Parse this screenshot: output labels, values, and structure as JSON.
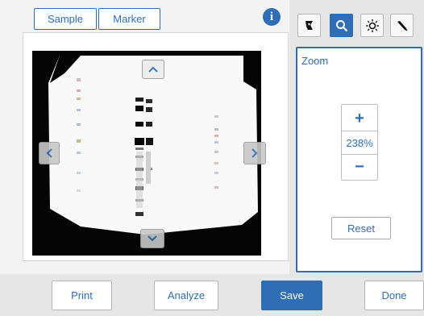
{
  "tabs": {
    "sample_label": "Sample",
    "marker_label": "Marker"
  },
  "info": {
    "label": "i",
    "icon": "info-icon"
  },
  "image_view": {
    "nav_icons": [
      "chevron-up-icon",
      "chevron-down-icon",
      "chevron-left-icon",
      "chevron-right-icon"
    ]
  },
  "toolbar": {
    "tools": [
      {
        "name": "crop",
        "icon": "crop-icon",
        "active": false
      },
      {
        "name": "zoom",
        "icon": "magnifier-icon",
        "active": true
      },
      {
        "name": "brightness",
        "icon": "brightness-icon",
        "active": false
      },
      {
        "name": "picker",
        "icon": "eyedropper-icon",
        "active": false
      }
    ]
  },
  "zoom_panel": {
    "title": "Zoom",
    "plus_label": "+",
    "value": "238%",
    "minus_label": "−",
    "reset_label": "Reset"
  },
  "actions": {
    "print_label": "Print",
    "analyze_label": "Analyze",
    "save_label": "Save",
    "done_label": "Done"
  },
  "colors": {
    "accent": "#2f6eb5",
    "panel_bg": "#e6e6e6",
    "image_bg": "#050505"
  }
}
